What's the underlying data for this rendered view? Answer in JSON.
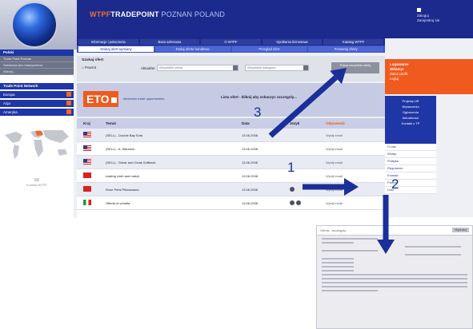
{
  "header": {
    "title_accent": "WTPF",
    "title_main": "TRADEPOINT",
    "title_light": "POZNAN POLAND",
    "user_line1": "Zaloguj",
    "user_line2": "Zarejestruj sie"
  },
  "top_tabs": [
    "Informacje i polaczenia",
    "Baza adresowa",
    "O WTPF",
    "Spotkania biznesowe",
    "Katalog WTPF"
  ],
  "sub_tabs": [
    "Szukaj ofert wymiany",
    "Dodaj oferte handlowa",
    "Przeglad ofert",
    "Porownaj oferty"
  ],
  "sidebar": {
    "section_title": "Polski",
    "items": [
      "Trade Point Poznan",
      "Swiatowa siec tradepointow",
      "Wiecej..."
    ],
    "network_title": "Trade Point Network",
    "dropdowns": [
      "Europa",
      "Azja",
      "Ameryka"
    ],
    "contact_line1": "Kontakt WTPF",
    "contact_icon": "mail-icon"
  },
  "search": {
    "title": "Szukaj ofert",
    "home_label": "Powrot",
    "region_label": "Aktualne",
    "region_value": "Wszystkie oferty",
    "filter_value": "Wszystkie kategorie",
    "button_label": "Pokaz wszystkie oferty"
  },
  "eto": {
    "logo": "ETO",
    "desc": "electronic trade opportunities",
    "text": "Lista ofert - kliknij aby zobaczyc szczegoly..."
  },
  "table": {
    "headers": [
      "Kraj",
      "Temat",
      "Data",
      "Jezyk",
      "Odpowiedz"
    ],
    "rows": [
      {
        "flag": "us",
        "topic": "(SELL) - Double Bay Sofa",
        "date": "13.06.2008",
        "lang_icons": 0,
        "answer": "Wyslij email"
      },
      {
        "flag": "us",
        "topic": "(SELL) - A. Mariners",
        "date": "13.06.2008",
        "lang_icons": 0,
        "answer": "Wyslij email"
      },
      {
        "flag": "us",
        "topic": "(SELL) - Shear and Cloak Softback",
        "date": "13.06.2008",
        "lang_icons": 0,
        "answer": "Wyslij email"
      },
      {
        "flag": "cn",
        "topic": "making cloth and match",
        "date": "13.06.2008",
        "lang_icons": 0,
        "answer": "Wyslij email"
      },
      {
        "flag": "cn",
        "topic": "Rose Petal Pillowcases",
        "date": "13.06.2008",
        "lang_icons": 1,
        "answer": "Wyslij email"
      },
      {
        "flag": "it",
        "topic": "Offerta di vendita",
        "date": "13.06.2008",
        "lang_icons": 2,
        "answer": "Wyslij email"
      }
    ]
  },
  "right_sidebar": {
    "login_title": "Logowanie",
    "login_line2": "Witamy!",
    "login_line3": "Zaloz profil",
    "login_line4": "Loguj",
    "links": [
      "Projekty UE",
      "Wydarzenia",
      "Ogloszenia",
      "Aktualnosci",
      "Kontakt z TP"
    ],
    "links2": [
      "O nas",
      "Wstep",
      "Polityka",
      "Regulamin",
      "Kontakt",
      "Pomoc",
      "Linki"
    ]
  },
  "document": {
    "title": "Oferta - szczegoly",
    "top_right": "Wydrukuj"
  },
  "annotations": {
    "label_1": "1",
    "label_2": "2",
    "label_3": "3",
    "arrow_color": "#1a2f9a"
  }
}
